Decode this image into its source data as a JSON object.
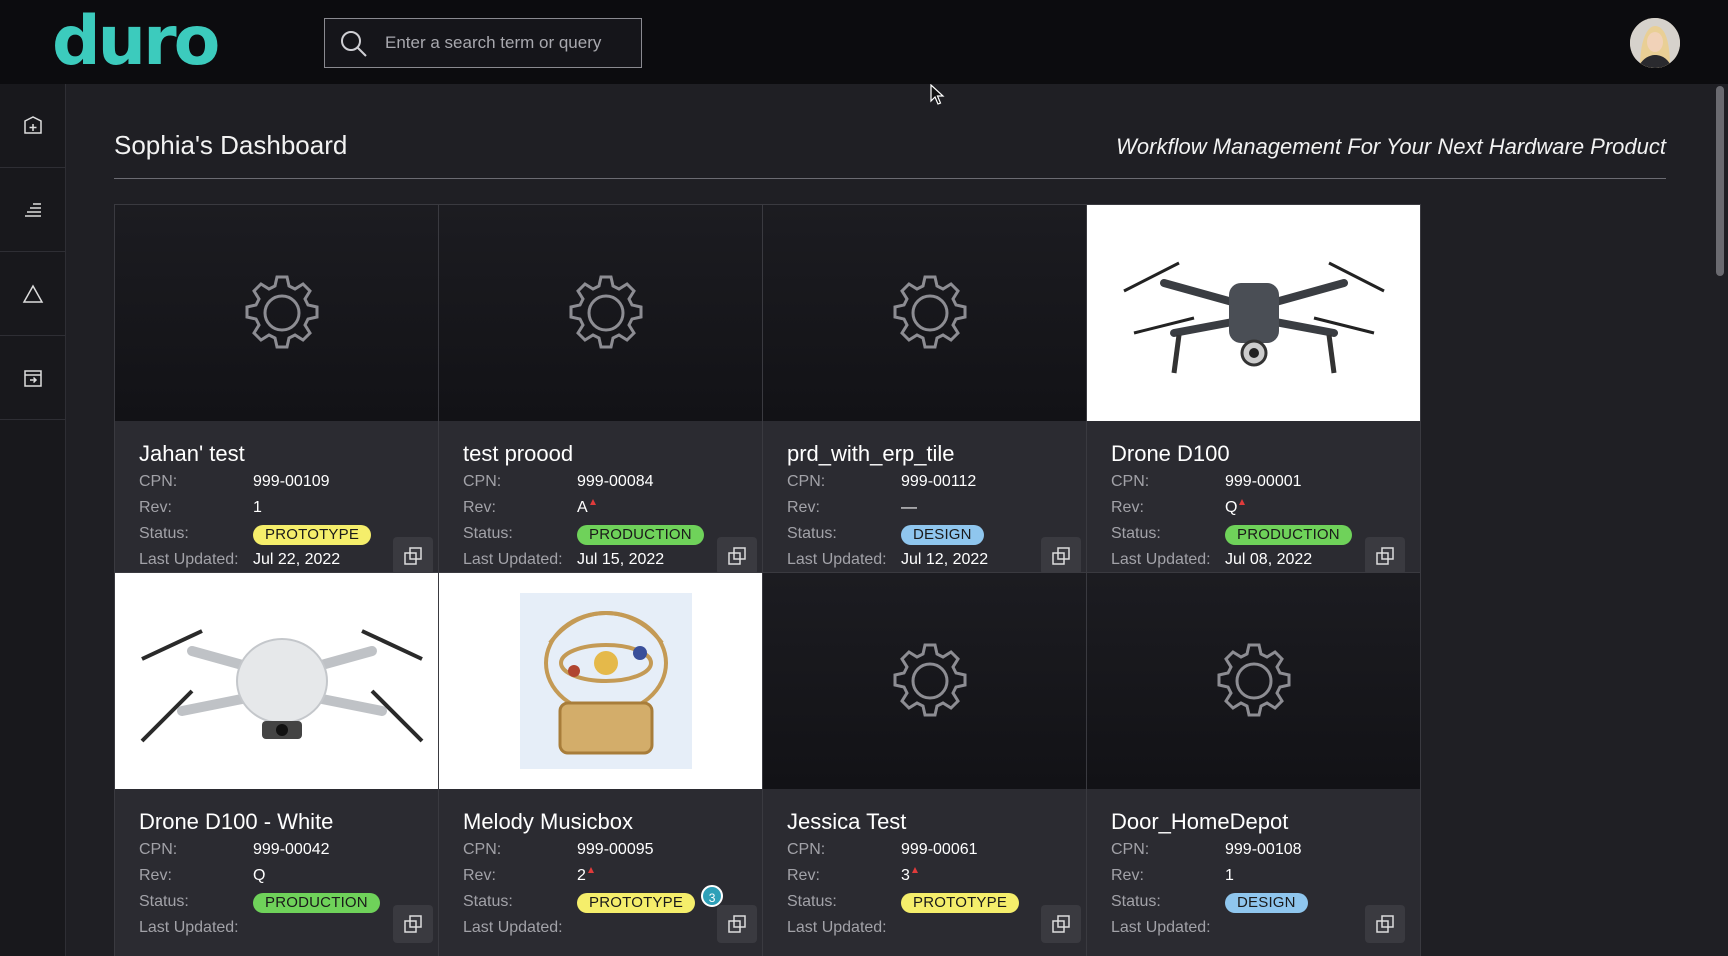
{
  "app": {
    "logo": "duro"
  },
  "search": {
    "placeholder": "Enter a search term or query"
  },
  "sidebar": {
    "items": [
      {
        "icon": "add-product-icon"
      },
      {
        "icon": "list-icon"
      },
      {
        "icon": "change-order-icon"
      },
      {
        "icon": "import-icon"
      }
    ]
  },
  "dashboard": {
    "title": "Sophia's Dashboard",
    "tagline": "Workflow Management For Your Next Hardware Product"
  },
  "labels": {
    "cpn": "CPN:",
    "rev": "Rev:",
    "status": "Status:",
    "updated": "Last Updated:"
  },
  "cards": [
    {
      "name": "Jahan' test",
      "cpn": "999-00109",
      "rev": "1",
      "rev_flag": false,
      "status": "PROTOTYPE",
      "updated": "Jul 22, 2022",
      "image": "gear-icon"
    },
    {
      "name": "test proood",
      "cpn": "999-00084",
      "rev": "A",
      "rev_flag": true,
      "status": "PRODUCTION",
      "updated": "Jul 15, 2022",
      "image": "gear-icon"
    },
    {
      "name": "prd_with_erp_tile",
      "cpn": "999-00112",
      "rev": "—",
      "rev_flag": false,
      "status": "DESIGN",
      "updated": "Jul 12, 2022",
      "image": "gear-icon"
    },
    {
      "name": "Drone D100",
      "cpn": "999-00001",
      "rev": "Q",
      "rev_flag": true,
      "status": "PRODUCTION",
      "updated": "Jul 08, 2022",
      "image": "drone-dark-photo"
    },
    {
      "name": "Drone D100 - White",
      "cpn": "999-00042",
      "rev": "Q",
      "rev_flag": false,
      "status": "PRODUCTION",
      "updated": "",
      "image": "drone-white-photo"
    },
    {
      "name": "Melody Musicbox",
      "cpn": "999-00095",
      "rev": "2",
      "rev_flag": true,
      "status": "PROTOTYPE",
      "updated": "",
      "image": "musicbox-photo",
      "notification": "3"
    },
    {
      "name": "Jessica Test",
      "cpn": "999-00061",
      "rev": "3",
      "rev_flag": true,
      "status": "PROTOTYPE",
      "updated": "",
      "image": "gear-icon"
    },
    {
      "name": "Door_HomeDepot",
      "cpn": "999-00108",
      "rev": "1",
      "rev_flag": false,
      "status": "DESIGN",
      "updated": "",
      "image": "gear-icon"
    }
  ],
  "colors": {
    "brand": "#3ccbbd",
    "prototype": "#f5ee6b",
    "production": "#6fd25a",
    "design": "#8fc6ee",
    "rev_flag": "#e03b3b"
  }
}
